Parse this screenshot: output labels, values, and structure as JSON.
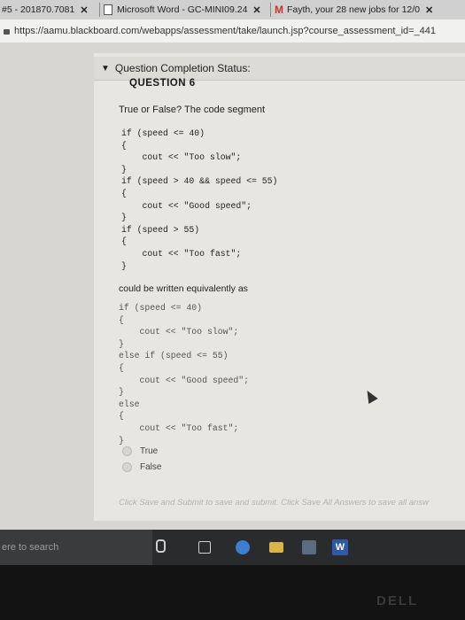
{
  "browser": {
    "tabs": [
      {
        "label": "#5 - 201870.7081",
        "close": "✕"
      },
      {
        "label": "Microsoft Word - GC-MINI09.24",
        "close": "✕"
      },
      {
        "label": "Fayth, your 28 new jobs for 12/0",
        "close": "✕"
      }
    ],
    "url": "https://aamu.blackboard.com/webapps/assessment/take/launch.jsp?course_assessment_id=_441"
  },
  "assessment": {
    "status_label": "Question Completion Status:",
    "question_title": "QUESTION 6",
    "prompt": "True or False? The code segment",
    "code_original": [
      "if (speed <= 40)",
      "{",
      "    cout << \"Too slow\";",
      "}",
      "if (speed > 40 && speed <= 55)",
      "{",
      "    cout << \"Good speed\";",
      "}",
      "if (speed > 55)",
      "{",
      "    cout << \"Too fast\";",
      "}"
    ],
    "bridge_text": "could be written equivalently as",
    "code_equivalent": [
      "if (speed <= 40)",
      "{",
      "    cout << \"Too slow\";",
      "}",
      "else if (speed <= 55)",
      "{",
      "    cout << \"Good speed\";",
      "}",
      "else",
      "{",
      "    cout << \"Too fast\";",
      "}"
    ],
    "answers": [
      "True",
      "False"
    ],
    "footer": "Click Save and Submit to save and submit. Click Save All Answers to save all answ"
  },
  "taskbar": {
    "search_placeholder": "ere to search",
    "word_icon_letter": "W"
  },
  "bezel_brand": "DELL"
}
